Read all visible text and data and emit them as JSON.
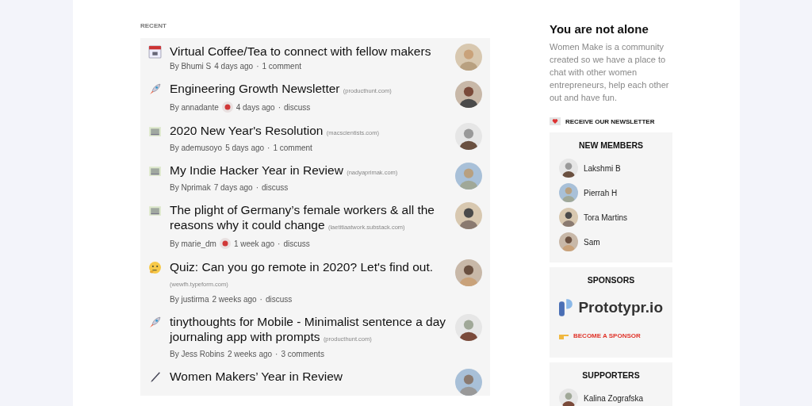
{
  "feed": {
    "heading": "RECENT",
    "posts": [
      {
        "kind": "calendar",
        "title": "Virtual Coffee/Tea to connect with fellow makers",
        "byline": "By Bhumi S",
        "badge": false,
        "time": "4 days ago",
        "separator": "·",
        "comments": "1 comment"
      },
      {
        "kind": "rocket",
        "title": "Engineering Growth Newsletter",
        "domain": "(producthunt.com)",
        "byline": "By annadante",
        "badge": true,
        "time": "4 days ago",
        "separator": "·",
        "comments": "discuss"
      },
      {
        "kind": "image",
        "title": "2020 New Year's Resolution",
        "domain": "(macscientists.com)",
        "byline": "By ademusoyo",
        "badge": false,
        "time": "5 days ago",
        "separator": "·",
        "comments": "1 comment"
      },
      {
        "kind": "image",
        "title": "My Indie Hacker Year in Review",
        "domain": "(nadyaprimak.com)",
        "byline": "By Nprimak",
        "badge": false,
        "time": "7 days ago",
        "separator": "·",
        "comments": "discuss"
      },
      {
        "kind": "image",
        "title": "The plight of Germany’s female workers & all the reasons why it could change",
        "domain": "(laetitiaatwork.substack.com)",
        "byline": "By marie_dm",
        "badge": true,
        "time": "1 week ago",
        "separator": "·",
        "comments": "discuss"
      },
      {
        "kind": "thinking",
        "title": "Quiz: Can you go remote in 2020? Let's find out.",
        "domain": "(wewfh.typeform.com)",
        "byline": "By justirma",
        "badge": false,
        "time": "2 weeks ago",
        "separator": "·",
        "comments": "discuss"
      },
      {
        "kind": "rocket",
        "title": "tinythoughts for Mobile - Minimalist sentence a day journaling app with prompts",
        "domain": "(producthunt.com)",
        "byline": "By Jess Robins",
        "badge": false,
        "time": "2 weeks ago",
        "separator": "·",
        "comments": "3 comments"
      },
      {
        "kind": "pen",
        "title": "Women Makers’ Year in Review"
      }
    ]
  },
  "sidebar": {
    "title": "You are not alone",
    "text": "Women Make is a community created so we have a place to chat with other women entrepreneurs, help each other out and have fun.",
    "newsletter": "RECEIVE OUR NEWSLETTER",
    "new_members": {
      "heading": "NEW MEMBERS",
      "members": [
        "Lakshmi B",
        "Pierrah H",
        "Tora Martins",
        "Sam"
      ]
    },
    "sponsors": {
      "heading": "SPONSORS",
      "sponsor": "Prototypr.io",
      "cta": "BECOME A SPONSOR"
    },
    "supporters": {
      "heading": "SUPPORTERS",
      "members": [
        "Kalina Zografska"
      ]
    }
  }
}
